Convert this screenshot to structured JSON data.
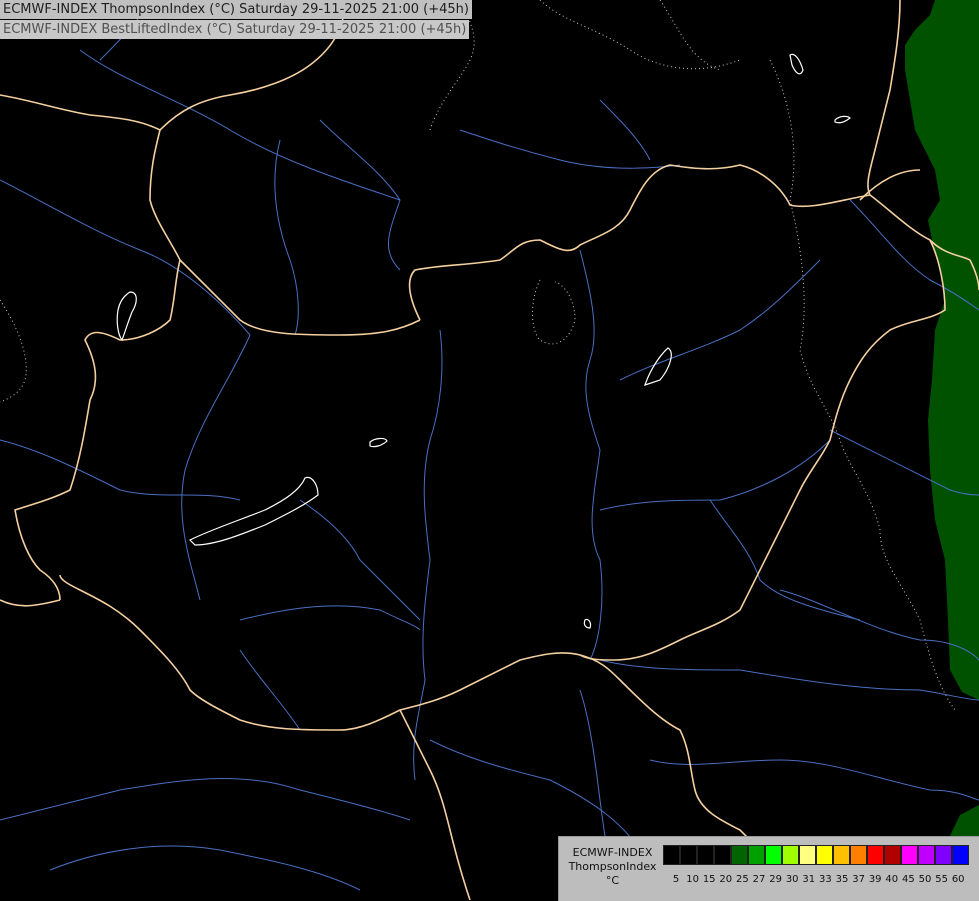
{
  "header": {
    "line1": "ECMWF-INDEX ThompsonIndex (°C) Saturday 29-11-2025 21:00 (+45h)",
    "line2": "ECMWF-INDEX BestLiftedIndex (°C) Saturday 29-11-2025 21:00 (+45h)"
  },
  "legend": {
    "title_line1": "ECMWF-INDEX",
    "title_line2": "ThompsonIndex",
    "title_line3": "°C",
    "swatches": [
      {
        "color": "#000000"
      },
      {
        "color": "#000000"
      },
      {
        "color": "#000000"
      },
      {
        "color": "#000000"
      },
      {
        "color": "#006400"
      },
      {
        "color": "#00a000"
      },
      {
        "color": "#00ff00"
      },
      {
        "color": "#a0ff00"
      },
      {
        "color": "#ffff80"
      },
      {
        "color": "#ffff00"
      },
      {
        "color": "#ffc000"
      },
      {
        "color": "#ff8000"
      },
      {
        "color": "#ff0000"
      },
      {
        "color": "#b00000"
      },
      {
        "color": "#ff00ff"
      },
      {
        "color": "#c000ff"
      },
      {
        "color": "#8000ff"
      },
      {
        "color": "#0000ff"
      }
    ],
    "ticks": [
      "5",
      "10",
      "15",
      "20",
      "25",
      "27",
      "29",
      "30",
      "31",
      "33",
      "35",
      "37",
      "39",
      "40",
      "45",
      "50",
      "55",
      "60"
    ]
  },
  "map": {
    "background_color": "#000000",
    "border_color": "#ffd8a8",
    "river_color": "#5070c8",
    "highlight_fill_color": "#005200",
    "lake_outline_color": "#ffffff",
    "contour_color": "#c8c8c8"
  }
}
